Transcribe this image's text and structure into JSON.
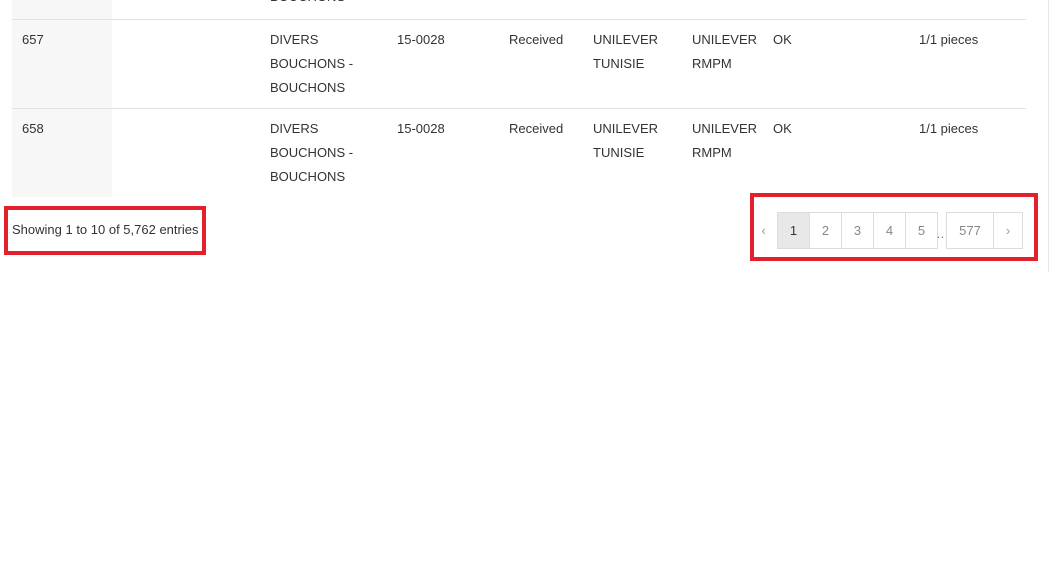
{
  "table": {
    "partial_row": {
      "desc": "BOUCHONS"
    },
    "rows": [
      {
        "id": "657",
        "desc": "DIVERS\nBOUCHONS -\nBOUCHONS",
        "ref": "15-0028",
        "status": "Received",
        "client": "UNILEVER\nTUNISIE",
        "supplier": "UNILEVER\nRMPM",
        "state": "OK",
        "qty": "1/1 pieces"
      },
      {
        "id": "658",
        "desc": "DIVERS\nBOUCHONS -\nBOUCHONS",
        "ref": "15-0028",
        "status": "Received",
        "client": "UNILEVER\nTUNISIE",
        "supplier": "UNILEVER\nRMPM",
        "state": "OK",
        "qty": "1/1 pieces"
      }
    ]
  },
  "info": {
    "text": "Showing 1 to 10 of 5,762 entries"
  },
  "pagination": {
    "prev_icon": "chevron-left-icon",
    "prev_glyph": "‹",
    "pages": [
      "1",
      "2",
      "3",
      "4",
      "5"
    ],
    "active_page": "1",
    "ellipsis": "…",
    "last_page": "577",
    "next_icon": "chevron-right-icon",
    "next_glyph": "›"
  },
  "colors": {
    "highlight": "#e3202b",
    "active_page_bg": "#e8e8e8"
  }
}
